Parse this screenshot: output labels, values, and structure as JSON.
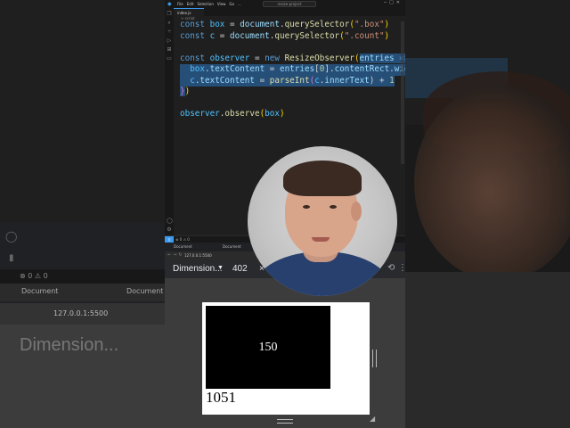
{
  "editor": {
    "menu": [
      "File",
      "Edit",
      "Selection",
      "View",
      "Go",
      "..."
    ],
    "search_text": "resize-project",
    "tab_label": "index.js",
    "breadcrumb": "> script",
    "lines": {
      "l1": [
        "const ",
        "box",
        " = ",
        "document",
        ".",
        "querySelector",
        "(",
        "\".box\"",
        ")"
      ],
      "l2": [
        "const ",
        "c",
        " = ",
        "document",
        ".",
        "querySelector",
        "(",
        "\".count\"",
        ")"
      ],
      "l3": [
        "const ",
        "observer",
        " = ",
        "new ",
        "ResizeObserver",
        "(",
        "entries",
        " => ",
        "{"
      ],
      "l4": [
        "  ",
        "box",
        ".",
        "textContent",
        " = ",
        "entries",
        "[",
        "0",
        "].",
        "contentRect",
        ".",
        "width"
      ],
      "l5": [
        "  ",
        "c",
        ".",
        "textContent",
        " = ",
        "parseInt",
        "(",
        "c",
        ".",
        "innerText",
        ") + ",
        "1"
      ],
      "l6": [
        "}",
        ")"
      ],
      "l7": [
        "observer",
        ".",
        "observe",
        "(",
        "box",
        ")"
      ]
    },
    "status_errors": "⊗ 0 ⚠ 0"
  },
  "browser": {
    "tab_title": "Document",
    "tab_title_2": "Document",
    "url": "127.0.0.1:5500"
  },
  "devtools": {
    "device_label": "Dimension...",
    "width_value": "402",
    "close_symbol": "×"
  },
  "preview": {
    "box_text": "150",
    "count_text": "1051"
  },
  "colors": {
    "editor_bg": "#1f1f1f",
    "selection": "#264f78",
    "keyword": "#569cd6",
    "function": "#dcdcaa",
    "string": "#ce9178"
  }
}
